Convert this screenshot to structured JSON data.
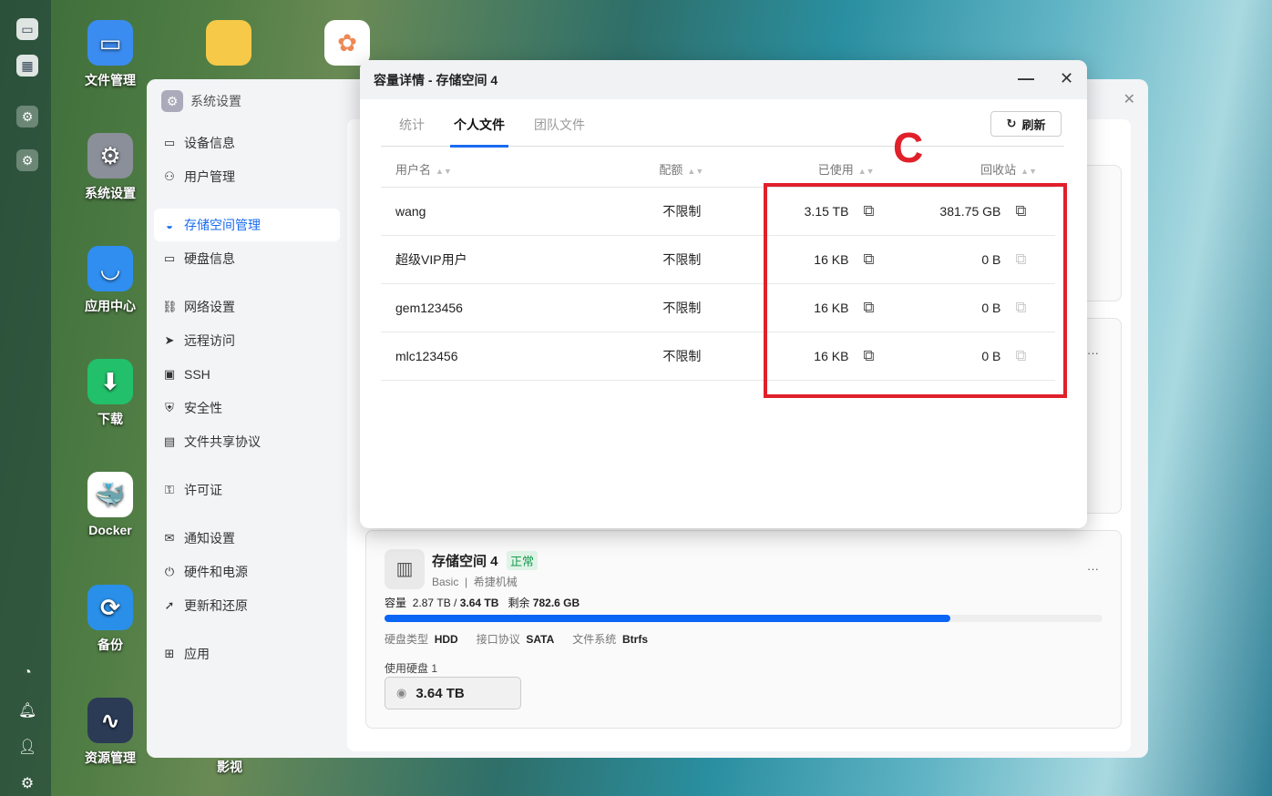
{
  "dock": {
    "icons": [
      "monitor-icon",
      "apps-icon",
      "settings-icon",
      "settings-icon"
    ],
    "bottom": [
      "activity-icon",
      "bell-icon",
      "user-icon",
      "gear-icon"
    ]
  },
  "desktop": [
    {
      "label": "文件管理",
      "color": "#3b8cf0",
      "glyph": "▭"
    },
    {
      "label": "系统设置",
      "color": "#8a8f99",
      "glyph": "⚙"
    },
    {
      "label": "应用中心",
      "color": "#2f8ef0",
      "glyph": "◡"
    },
    {
      "label": "下载",
      "color": "#22c06a",
      "glyph": "⬇"
    },
    {
      "label": "Docker",
      "color": "#ffffff",
      "glyph": "🐳"
    },
    {
      "label": "备份",
      "color": "#2a8fe8",
      "glyph": "⟳"
    },
    {
      "label": "资源管理",
      "color": "#2b3a55",
      "glyph": "∿"
    }
  ],
  "desktop_extra": {
    "label": "影视"
  },
  "settings": {
    "title": "系统设置",
    "nav": [
      "设备信息",
      "用户管理",
      "存储空间管理",
      "硬盘信息",
      "网络设置",
      "远程访问",
      "SSH",
      "安全性",
      "文件共享协议",
      "许可证",
      "通知设置",
      "硬件和电源",
      "更新和还原",
      "应用"
    ],
    "active": "存储空间管理"
  },
  "pool": {
    "name": "存储空间 4",
    "status": "正常",
    "type": "Basic",
    "brand": "希捷机械",
    "capacity_label": "容量",
    "used": "2.87 TB",
    "total": "3.64 TB",
    "free_label": "剩余",
    "free": "782.6 GB",
    "usage_percent": 78.8,
    "disk_type_label": "硬盘类型",
    "disk_type": "HDD",
    "iface_label": "接口协议",
    "iface": "SATA",
    "fs_label": "文件系统",
    "fs": "Btrfs",
    "disks_label": "使用硬盘 1",
    "disk_size": "3.64 TB"
  },
  "dialog": {
    "title": "容量详情 - 存储空间 4",
    "tabs": [
      "统计",
      "个人文件",
      "团队文件"
    ],
    "active_tab": "个人文件",
    "refresh": "刷新",
    "columns": [
      "用户名",
      "配额",
      "已使用",
      "回收站"
    ],
    "rows": [
      {
        "user": "wang",
        "quota": "不限制",
        "used": "3.15 TB",
        "recycle": "381.75 GB"
      },
      {
        "user": "超级VIP用户",
        "quota": "不限制",
        "used": "16 KB",
        "recycle": "0 B"
      },
      {
        "user": "gem123456",
        "quota": "不限制",
        "used": "16 KB",
        "recycle": "0 B"
      },
      {
        "user": "mlc123456",
        "quota": "不限制",
        "used": "16 KB",
        "recycle": "0 B"
      }
    ]
  },
  "annotation": {
    "letter": "C",
    "color": "#e0202a"
  }
}
